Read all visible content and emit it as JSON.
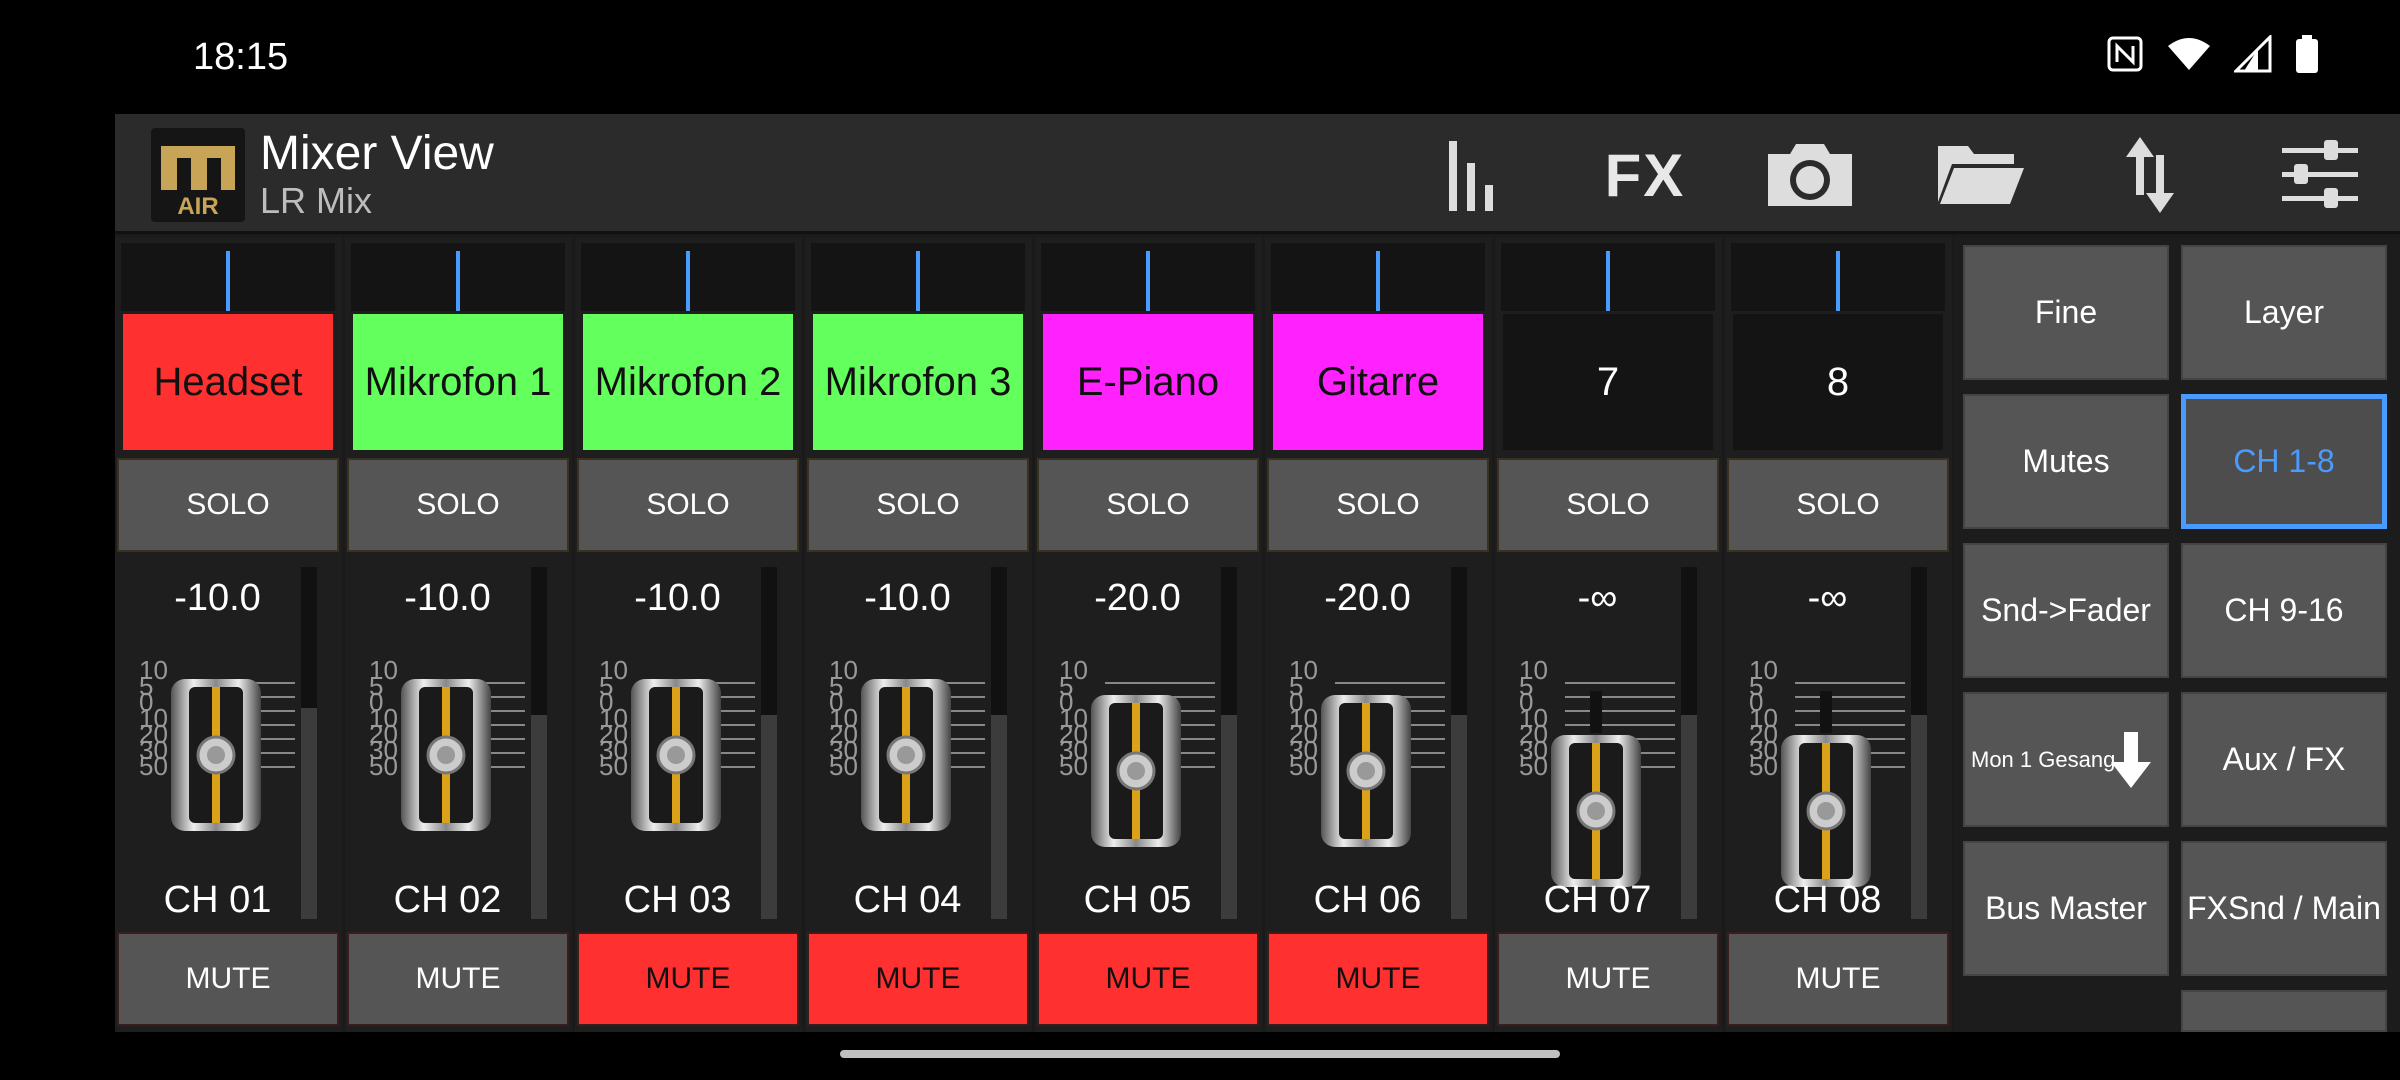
{
  "status": {
    "time": "18:15",
    "icons": [
      "nfc-icon",
      "wifi-icon",
      "signal-icon",
      "battery-icon"
    ]
  },
  "header": {
    "logo_text": "AIR",
    "title": "Mixer View",
    "subtitle": "LR Mix",
    "fx_label": "FX",
    "toolbar_icons": [
      "meters-icon",
      "fx-icon",
      "camera-icon",
      "folder-icon",
      "sync-icon",
      "sliders-icon"
    ]
  },
  "colors": {
    "red": "#ff3030",
    "green": "#63ff5c",
    "magenta": "#ff22ff",
    "dark": "#141414",
    "accent_blue": "#4a9bff"
  },
  "scale_labels": [
    "10",
    "5",
    "0",
    "10",
    "20",
    "30",
    "50"
  ],
  "channels": [
    {
      "name": "Headset",
      "color": "#ff3030",
      "solo": "SOLO",
      "value": "-10.0",
      "label": "CH 01",
      "mute": "MUTE",
      "muted": false,
      "fader": 0.75,
      "meter": 0.6
    },
    {
      "name": "Mikrofon 1",
      "color": "#63ff5c",
      "solo": "SOLO",
      "value": "-10.0",
      "label": "CH 02",
      "mute": "MUTE",
      "muted": false,
      "fader": 0.75,
      "meter": 0.58
    },
    {
      "name": "Mikrofon 2",
      "color": "#63ff5c",
      "solo": "SOLO",
      "value": "-10.0",
      "label": "CH 03",
      "mute": "MUTE",
      "muted": true,
      "fader": 0.75,
      "meter": 0.58
    },
    {
      "name": "Mikrofon 3",
      "color": "#63ff5c",
      "solo": "SOLO",
      "value": "-10.0",
      "label": "CH 04",
      "mute": "MUTE",
      "muted": true,
      "fader": 0.75,
      "meter": 0.58
    },
    {
      "name": "E-Piano",
      "color": "#ff22ff",
      "solo": "SOLO",
      "value": "-20.0",
      "label": "CH 05",
      "mute": "MUTE",
      "muted": true,
      "fader": 0.65,
      "meter": 0.58
    },
    {
      "name": "Gitarre",
      "color": "#ff22ff",
      "solo": "SOLO",
      "value": "-20.0",
      "label": "CH 06",
      "mute": "MUTE",
      "muted": true,
      "fader": 0.65,
      "meter": 0.58
    },
    {
      "name": "7",
      "color": "#141414",
      "solo": "SOLO",
      "value": "-∞",
      "label": "CH 07",
      "mute": "MUTE",
      "muted": false,
      "fader": 0.4,
      "meter": 0.58
    },
    {
      "name": "8",
      "color": "#141414",
      "solo": "SOLO",
      "value": "-∞",
      "label": "CH 08",
      "mute": "MUTE",
      "muted": false,
      "fader": 0.4,
      "meter": 0.58
    }
  ],
  "right_panel": {
    "left_col": [
      "Fine",
      "Mutes",
      "Snd->Fader",
      "Mon 1 Gesang",
      "Bus Master"
    ],
    "right_col": [
      "Layer",
      "CH 1-8",
      "CH 9-16",
      "Aux / FX",
      "FXSnd / Main"
    ],
    "active": "CH 1-8"
  }
}
